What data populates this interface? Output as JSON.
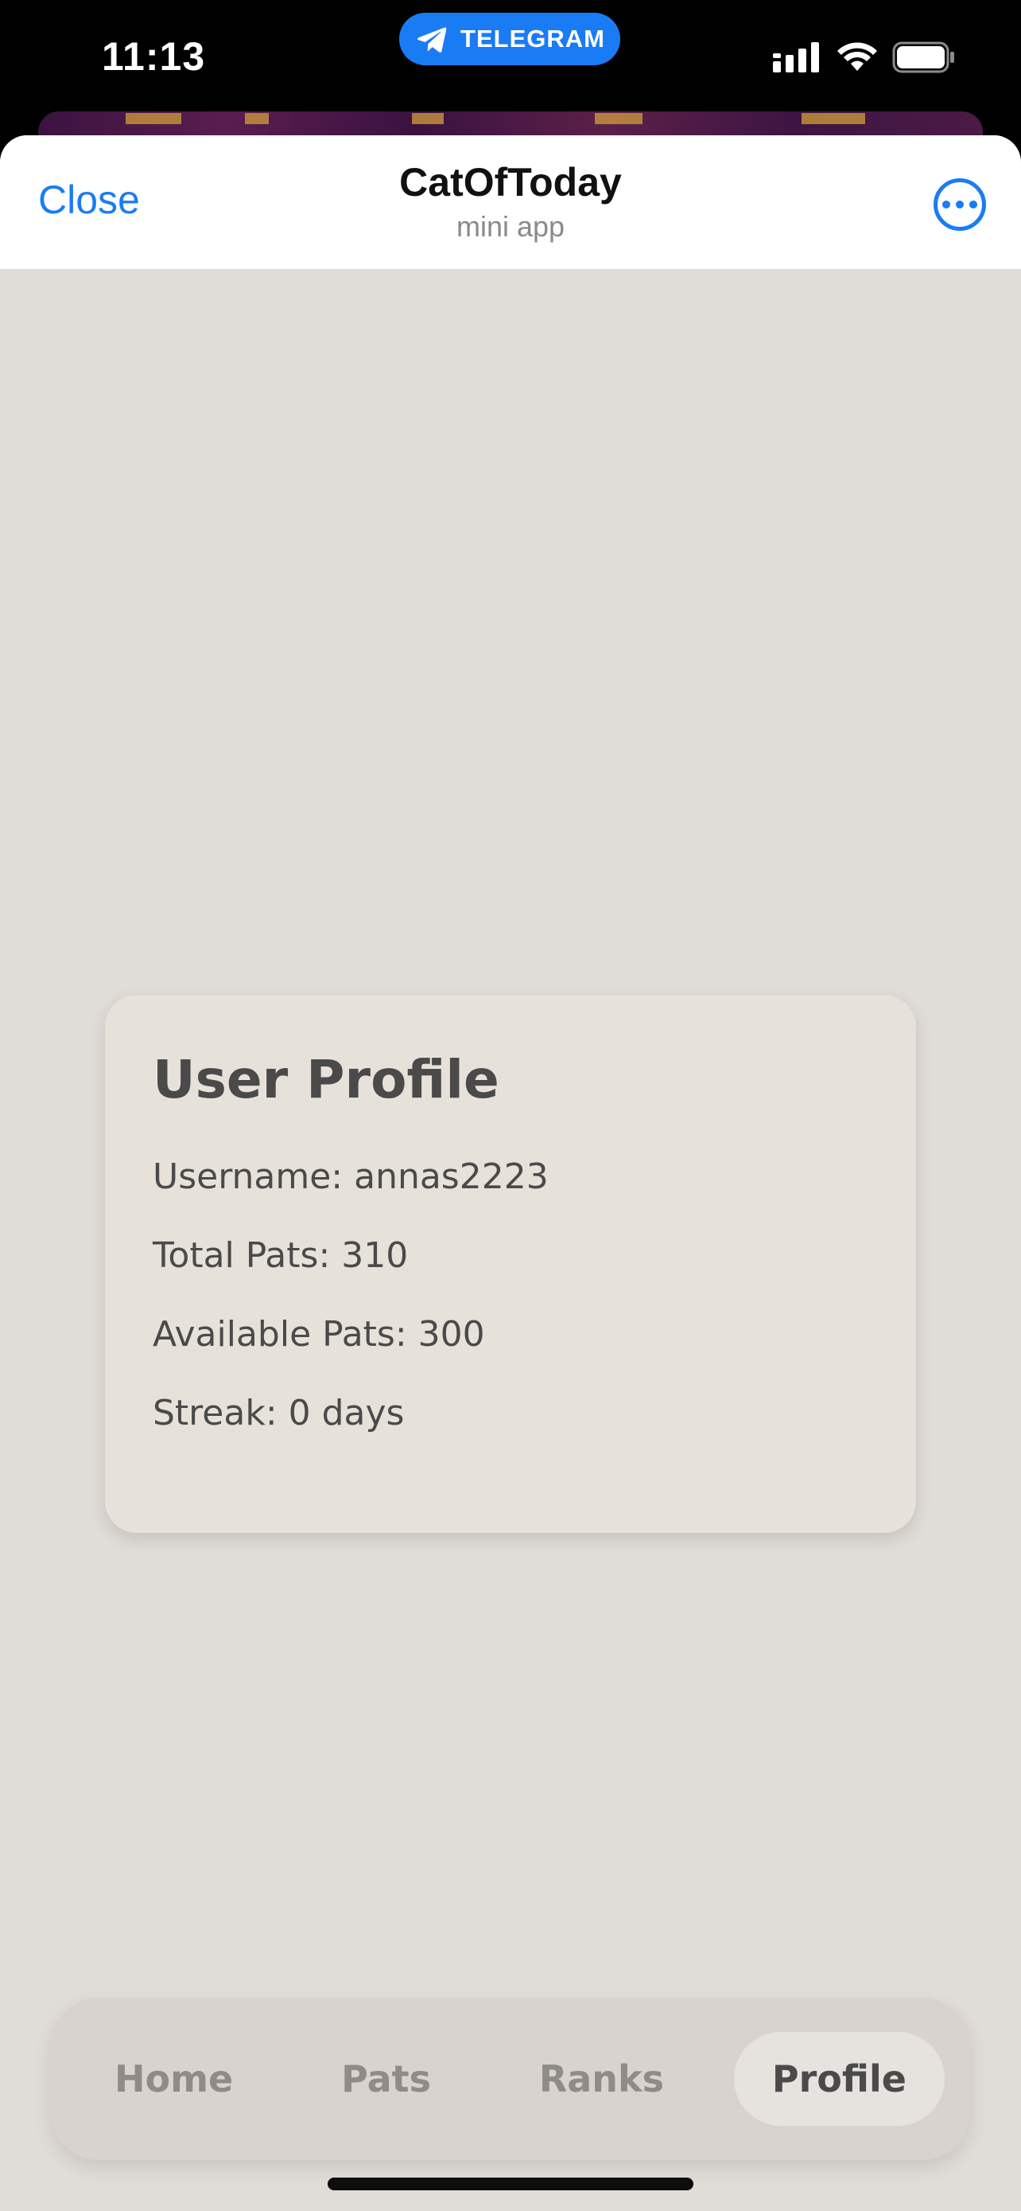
{
  "status_bar": {
    "time": "11:13",
    "pill_label": "TELEGRAM",
    "pill_color": "#1a7cf5"
  },
  "header": {
    "close_label": "Close",
    "title": "CatOfToday",
    "subtitle": "mini app",
    "more_icon": "ellipsis-circle-icon"
  },
  "profile": {
    "title": "User Profile",
    "username": "Username: annas2223",
    "total_pats": "Total Pats: 310",
    "available_pats": "Available Pats: 300",
    "streak": "Streak: 0 days"
  },
  "nav": {
    "items": [
      {
        "label": "Home",
        "active": false
      },
      {
        "label": "Pats",
        "active": false
      },
      {
        "label": "Ranks",
        "active": false
      },
      {
        "label": "Profile",
        "active": true
      }
    ]
  },
  "colors": {
    "accent": "#1a7cf5",
    "background": "#e0dcd7",
    "card": "#e6e2d9",
    "text": "#4a4a4a"
  }
}
